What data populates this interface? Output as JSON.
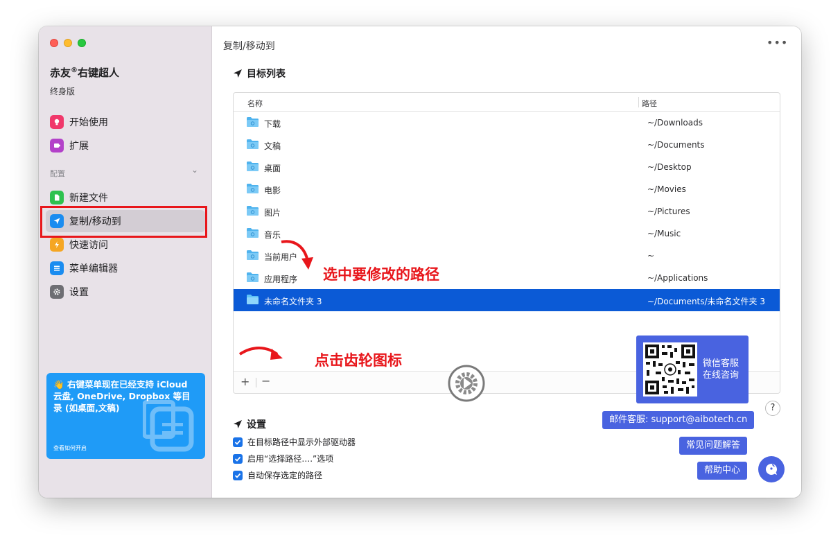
{
  "app": {
    "name_part1": "赤友",
    "registered": "®",
    "name_part2": "右键超人",
    "edition": "终身版"
  },
  "sidebar": {
    "items_top": [
      {
        "label": "开始使用",
        "icon": "lightbulb-icon",
        "color": "#f0386b"
      },
      {
        "label": "扩展",
        "icon": "puzzle-icon",
        "color": "#b341c9"
      }
    ],
    "section_label": "配置",
    "items_config": [
      {
        "label": "新建文件",
        "icon": "new-file-icon",
        "color": "#2ec24f"
      },
      {
        "label": "复制/移动到",
        "icon": "paper-plane-icon",
        "color": "#1a8cf0"
      },
      {
        "label": "快速访问",
        "icon": "lightning-icon",
        "color": "#f5a623"
      },
      {
        "label": "菜单编辑器",
        "icon": "list-icon",
        "color": "#1a8cf0"
      },
      {
        "label": "设置",
        "icon": "gear-icon",
        "color": "#6e6e73"
      }
    ],
    "promo": {
      "emoji": "👋",
      "text": "右键菜单现在已经支持 iCloud 云盘, OneDrive, Dropbox 等目录 (如桌面,文稿)",
      "link": "查看如何开启"
    }
  },
  "main": {
    "title": "复制/移动到",
    "target_section": "目标列表",
    "columns": {
      "name": "名称",
      "path": "路径"
    },
    "rows": [
      {
        "name": "下载",
        "path": "~/Downloads",
        "icon": "download-folder-icon"
      },
      {
        "name": "文稿",
        "path": "~/Documents",
        "icon": "documents-folder-icon"
      },
      {
        "name": "桌面",
        "path": "~/Desktop",
        "icon": "desktop-folder-icon"
      },
      {
        "name": "电影",
        "path": "~/Movies",
        "icon": "movies-folder-icon"
      },
      {
        "name": "图片",
        "path": "~/Pictures",
        "icon": "pictures-folder-icon"
      },
      {
        "name": "音乐",
        "path": "~/Music",
        "icon": "music-folder-icon"
      },
      {
        "name": "当前用户",
        "path": "~",
        "icon": "home-folder-icon"
      },
      {
        "name": "应用程序",
        "path": "~/Applications",
        "icon": "applications-folder-icon"
      },
      {
        "name": "未命名文件夹 3",
        "path": "~/Documents/未命名文件夹 3",
        "icon": "folder-icon",
        "selected": true
      }
    ],
    "footer": {
      "add": "+",
      "remove": "−"
    },
    "annotations": {
      "select_path": "选中要修改的路径",
      "click_gear": "点击齿轮图标"
    },
    "settings_section": "设置",
    "options": [
      {
        "label": "在目标路径中显示外部驱动器",
        "checked": true
      },
      {
        "label": "启用“选择路径….”选项",
        "checked": true
      },
      {
        "label": "自动保存选定的路径",
        "checked": true
      }
    ]
  },
  "support": {
    "qr_text_line1": "微信客服",
    "qr_text_line2": "在线咨询",
    "email": "邮件客服: support@aibotech.cn",
    "faq": "常见问题解答",
    "help_center": "帮助中心",
    "help_q": "?"
  },
  "colors": {
    "accent": "#0b5ad6",
    "support_blue": "#4963e0",
    "annotation_red": "#e8161b"
  }
}
